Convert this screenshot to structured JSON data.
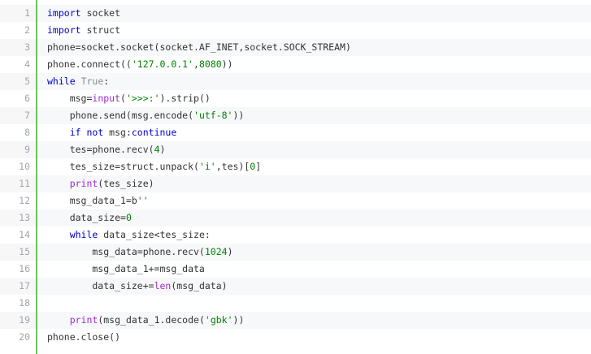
{
  "colors": {
    "gutter_border": "#6ec05b",
    "keyword": "#0000cc",
    "string": "#008200",
    "builtin": "#a12ad1",
    "line_number": "#9da6b0"
  },
  "lines": [
    {
      "n": "1",
      "tokens": [
        {
          "t": "kw",
          "v": "import"
        },
        {
          "t": "",
          "v": " socket"
        }
      ]
    },
    {
      "n": "2",
      "tokens": [
        {
          "t": "kw",
          "v": "import"
        },
        {
          "t": "",
          "v": " struct"
        }
      ]
    },
    {
      "n": "3",
      "tokens": [
        {
          "t": "",
          "v": "phone=socket.socket(socket.AF_INET,socket.SOCK_STREAM)"
        }
      ]
    },
    {
      "n": "4",
      "tokens": [
        {
          "t": "",
          "v": "phone.connect(("
        },
        {
          "t": "str",
          "v": "'127.0.0.1'"
        },
        {
          "t": "",
          "v": ","
        },
        {
          "t": "num",
          "v": "8080"
        },
        {
          "t": "",
          "v": "))"
        }
      ]
    },
    {
      "n": "5",
      "tokens": [
        {
          "t": "kw",
          "v": "while"
        },
        {
          "t": "",
          "v": " "
        },
        {
          "t": "const",
          "v": "True"
        },
        {
          "t": "",
          "v": ":"
        }
      ]
    },
    {
      "n": "6",
      "tokens": [
        {
          "t": "",
          "v": "    msg="
        },
        {
          "t": "bi",
          "v": "input"
        },
        {
          "t": "",
          "v": "("
        },
        {
          "t": "str",
          "v": "'>>>:'"
        },
        {
          "t": "",
          "v": ").strip()"
        }
      ]
    },
    {
      "n": "7",
      "tokens": [
        {
          "t": "",
          "v": "    phone.send(msg.encode("
        },
        {
          "t": "str",
          "v": "'utf-8'"
        },
        {
          "t": "",
          "v": "))"
        }
      ]
    },
    {
      "n": "8",
      "tokens": [
        {
          "t": "",
          "v": "    "
        },
        {
          "t": "kw",
          "v": "if not"
        },
        {
          "t": "",
          "v": " msg:"
        },
        {
          "t": "kw",
          "v": "continue"
        }
      ]
    },
    {
      "n": "9",
      "tokens": [
        {
          "t": "",
          "v": "    tes=phone.recv("
        },
        {
          "t": "num",
          "v": "4"
        },
        {
          "t": "",
          "v": ")"
        }
      ]
    },
    {
      "n": "10",
      "tokens": [
        {
          "t": "",
          "v": "    tes_size=struct.unpack("
        },
        {
          "t": "str",
          "v": "'i'"
        },
        {
          "t": "",
          "v": ",tes)["
        },
        {
          "t": "num",
          "v": "0"
        },
        {
          "t": "",
          "v": "]"
        }
      ]
    },
    {
      "n": "11",
      "tokens": [
        {
          "t": "",
          "v": "    "
        },
        {
          "t": "bi",
          "v": "print"
        },
        {
          "t": "",
          "v": "(tes_size)"
        }
      ]
    },
    {
      "n": "12",
      "tokens": [
        {
          "t": "",
          "v": "    msg_data_1=b"
        },
        {
          "t": "str",
          "v": "''"
        }
      ]
    },
    {
      "n": "13",
      "tokens": [
        {
          "t": "",
          "v": "    data_size="
        },
        {
          "t": "num",
          "v": "0"
        }
      ]
    },
    {
      "n": "14",
      "tokens": [
        {
          "t": "",
          "v": "    "
        },
        {
          "t": "kw",
          "v": "while"
        },
        {
          "t": "",
          "v": " data_size<tes_size:"
        }
      ]
    },
    {
      "n": "15",
      "tokens": [
        {
          "t": "",
          "v": "        msg_data=phone.recv("
        },
        {
          "t": "num",
          "v": "1024"
        },
        {
          "t": "",
          "v": ")"
        }
      ]
    },
    {
      "n": "16",
      "tokens": [
        {
          "t": "",
          "v": "        msg_data_1+=msg_data"
        }
      ]
    },
    {
      "n": "17",
      "tokens": [
        {
          "t": "",
          "v": "        data_size+="
        },
        {
          "t": "bi",
          "v": "len"
        },
        {
          "t": "",
          "v": "(msg_data)"
        }
      ]
    },
    {
      "n": "18",
      "tokens": []
    },
    {
      "n": "19",
      "tokens": [
        {
          "t": "",
          "v": "    "
        },
        {
          "t": "bi",
          "v": "print"
        },
        {
          "t": "",
          "v": "(msg_data_1.decode("
        },
        {
          "t": "str",
          "v": "'gbk'"
        },
        {
          "t": "",
          "v": "))"
        }
      ]
    },
    {
      "n": "20",
      "tokens": [
        {
          "t": "",
          "v": "phone.close()"
        }
      ]
    }
  ]
}
